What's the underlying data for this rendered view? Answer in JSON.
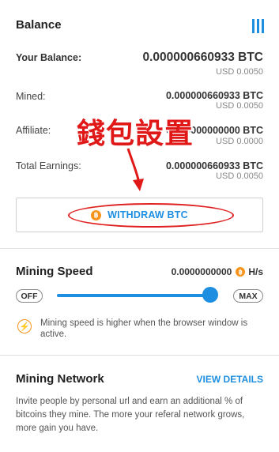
{
  "balance": {
    "title": "Balance",
    "menu_icon": "menu-bars-icon",
    "rows": [
      {
        "label": "Your Balance:",
        "btc": "0.000000660933 BTC",
        "usd": "USD 0.0050"
      },
      {
        "label": "Mined:",
        "btc": "0.000000660933 BTC",
        "usd": "USD 0.0050"
      },
      {
        "label": "Affiliate:",
        "btc": "0.000000000000 BTC",
        "usd": "USD 0.0000"
      },
      {
        "label": "Total Earnings:",
        "btc": "0.000000660933 BTC",
        "usd": "USD 0.0050"
      }
    ],
    "withdraw_label": "WITHDRAW BTC",
    "btc_symbol": "฿"
  },
  "annotation": {
    "text": "錢包設置",
    "color": "#e01818"
  },
  "mining_speed": {
    "title": "Mining Speed",
    "value": "0.0000000000",
    "unit": "H/s",
    "off_label": "OFF",
    "max_label": "MAX",
    "slider_level": 0.98,
    "notice": "Mining speed is higher when the browser window is active.",
    "notice_icon": "lightning-icon"
  },
  "mining_network": {
    "title": "Mining Network",
    "view_details": "VIEW DETAILS",
    "description": "Invite people by personal url and earn an additional % of bitcoins they mine. The more your referal network grows, more gain you have."
  },
  "colors": {
    "accent": "#1e8fe0",
    "btc_orange": "#f7931a",
    "annotation_red": "#e01818"
  }
}
